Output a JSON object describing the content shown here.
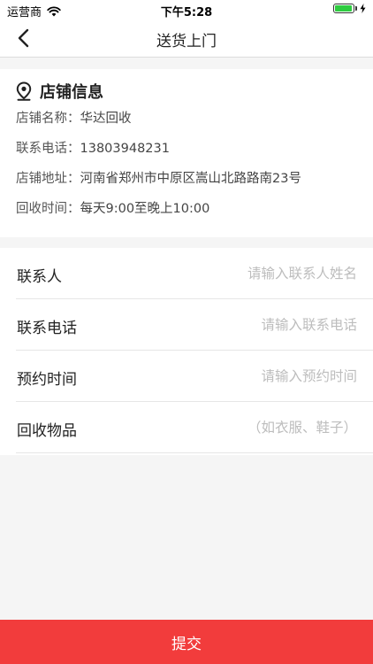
{
  "status_bar": {
    "carrier": "运营商",
    "time": "下午5:28",
    "battery_level": 0.95
  },
  "nav": {
    "title": "送货上门",
    "back_icon": "chevron-left-icon"
  },
  "store": {
    "icon": "location-pin-icon",
    "title": "店铺信息",
    "rows": [
      {
        "label": "店铺名称：",
        "value": "华达回收"
      },
      {
        "label": "联系电话：",
        "value": "13803948231"
      },
      {
        "label": "店铺地址：",
        "value": "河南省郑州市中原区嵩山北路路南23号"
      },
      {
        "label": "回收时间：",
        "value": "每天9:00至晚上10:00"
      }
    ]
  },
  "form": {
    "fields": [
      {
        "label": "联系人",
        "value": "",
        "placeholder": "请输入联系人姓名"
      },
      {
        "label": "联系电话",
        "value": "",
        "placeholder": "请输入联系电话"
      },
      {
        "label": "预约时间",
        "value": "",
        "placeholder": "请输入预约时间"
      },
      {
        "label": "回收物品",
        "value": "",
        "placeholder": "（如衣服、鞋子）"
      }
    ]
  },
  "submit": {
    "label": "提交"
  },
  "colors": {
    "accent": "#f23c3c",
    "placeholder": "#bdbdbd",
    "battery": "#2ecc40"
  }
}
